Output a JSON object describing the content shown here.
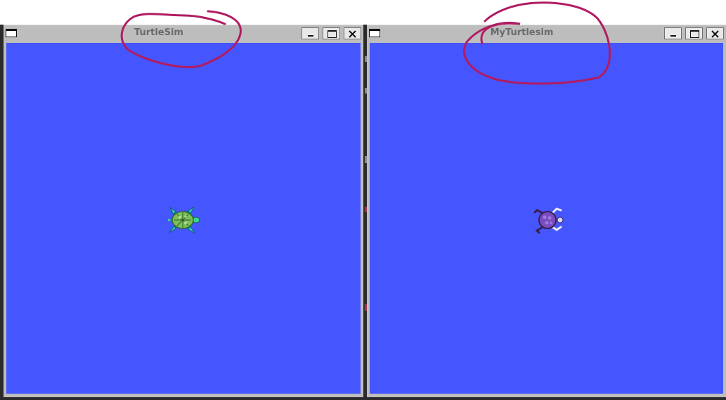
{
  "windows": [
    {
      "title": "TurtleSim",
      "background": "#4556ff",
      "turtle_icon": "green-turtle-icon",
      "controls": [
        "minimize-icon",
        "maximize-icon",
        "close-icon"
      ]
    },
    {
      "title": "MyTurtlesim",
      "background": "#4556ff",
      "turtle_icon": "purple-turtle-icon",
      "controls": [
        "minimize-icon",
        "maximize-icon",
        "close-icon"
      ]
    }
  ],
  "annotation": {
    "color": "#b01c62",
    "shape": "hand-drawn-circle"
  }
}
